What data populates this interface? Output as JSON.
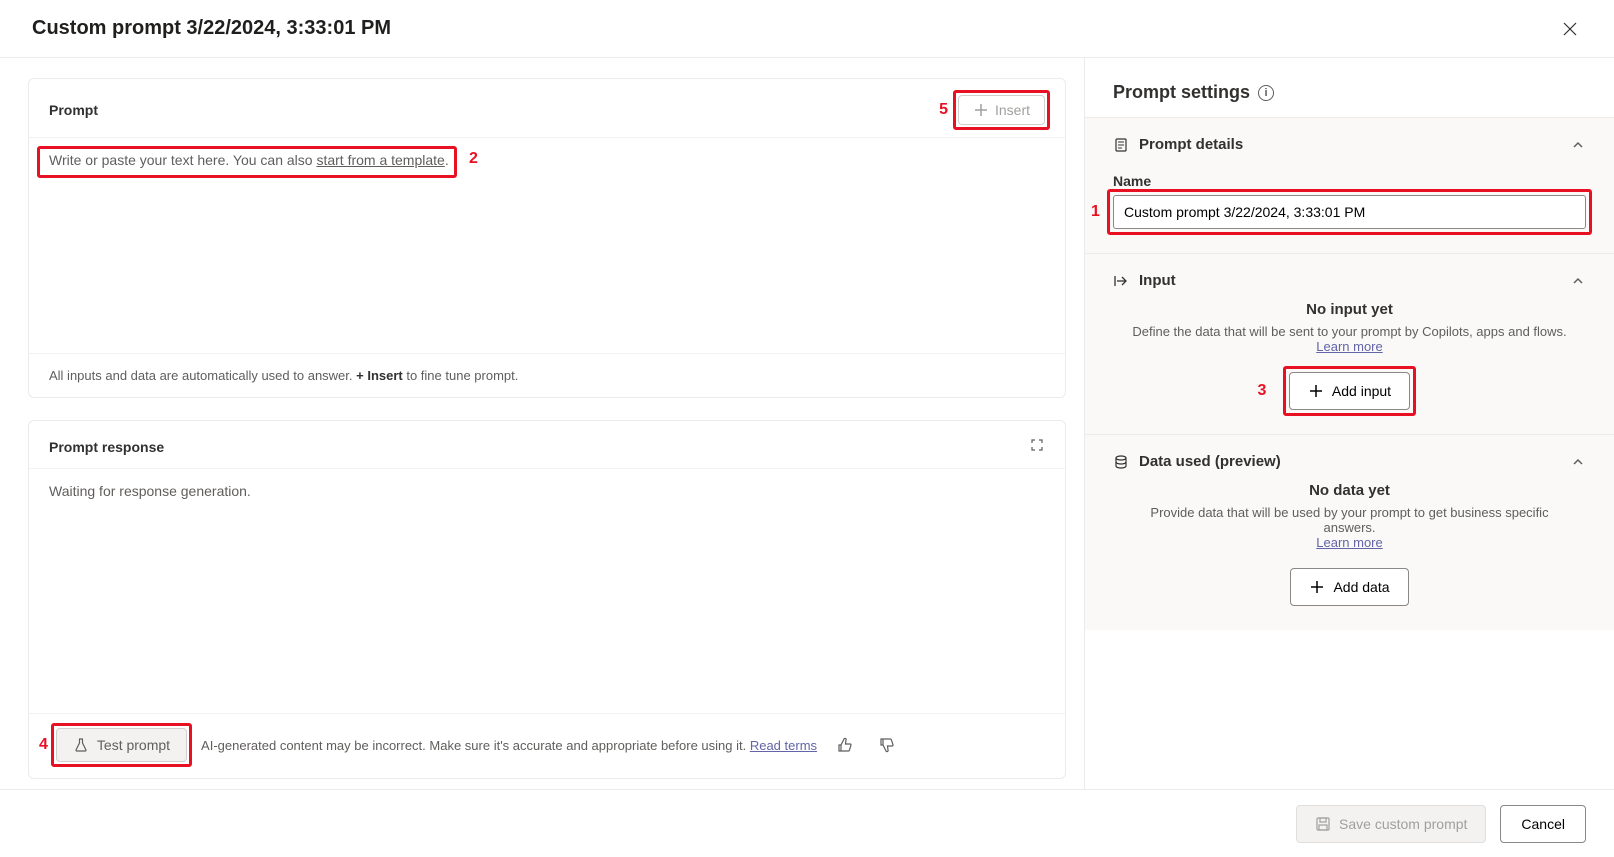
{
  "header": {
    "title": "Custom prompt 3/22/2024, 3:33:01 PM"
  },
  "prompt_panel": {
    "title": "Prompt",
    "insert_label": "Insert",
    "placeholder_prefix": "Write or paste your text here. You can also ",
    "template_link": "start from a template",
    "placeholder_suffix": ".",
    "hint_prefix": "All inputs and data are automatically used to answer. ",
    "hint_bold": "+ Insert",
    "hint_suffix": " to fine tune prompt."
  },
  "response_panel": {
    "title": "Prompt response",
    "waiting_text": "Waiting for response generation.",
    "test_label": "Test prompt",
    "disclaimer": "AI-generated content may be incorrect. Make sure it's accurate and appropriate before using it. ",
    "read_terms": "Read terms"
  },
  "settings": {
    "title": "Prompt settings",
    "details": {
      "heading": "Prompt details",
      "name_label": "Name",
      "name_value": "Custom prompt 3/22/2024, 3:33:01 PM"
    },
    "input": {
      "heading": "Input",
      "empty_title": "No input yet",
      "empty_sub": "Define the data that will be sent to your prompt by Copilots, apps and flows.",
      "learn_more": "Learn more",
      "add_label": "Add input"
    },
    "data": {
      "heading": "Data used (preview)",
      "empty_title": "No data yet",
      "empty_sub": "Provide data that will be used by your prompt to get business specific answers.",
      "learn_more": "Learn more",
      "add_label": "Add data"
    }
  },
  "footer": {
    "save_label": "Save custom prompt",
    "cancel_label": "Cancel"
  },
  "annotations": {
    "a1": "1",
    "a2": "2",
    "a3": "3",
    "a4": "4",
    "a5": "5"
  }
}
